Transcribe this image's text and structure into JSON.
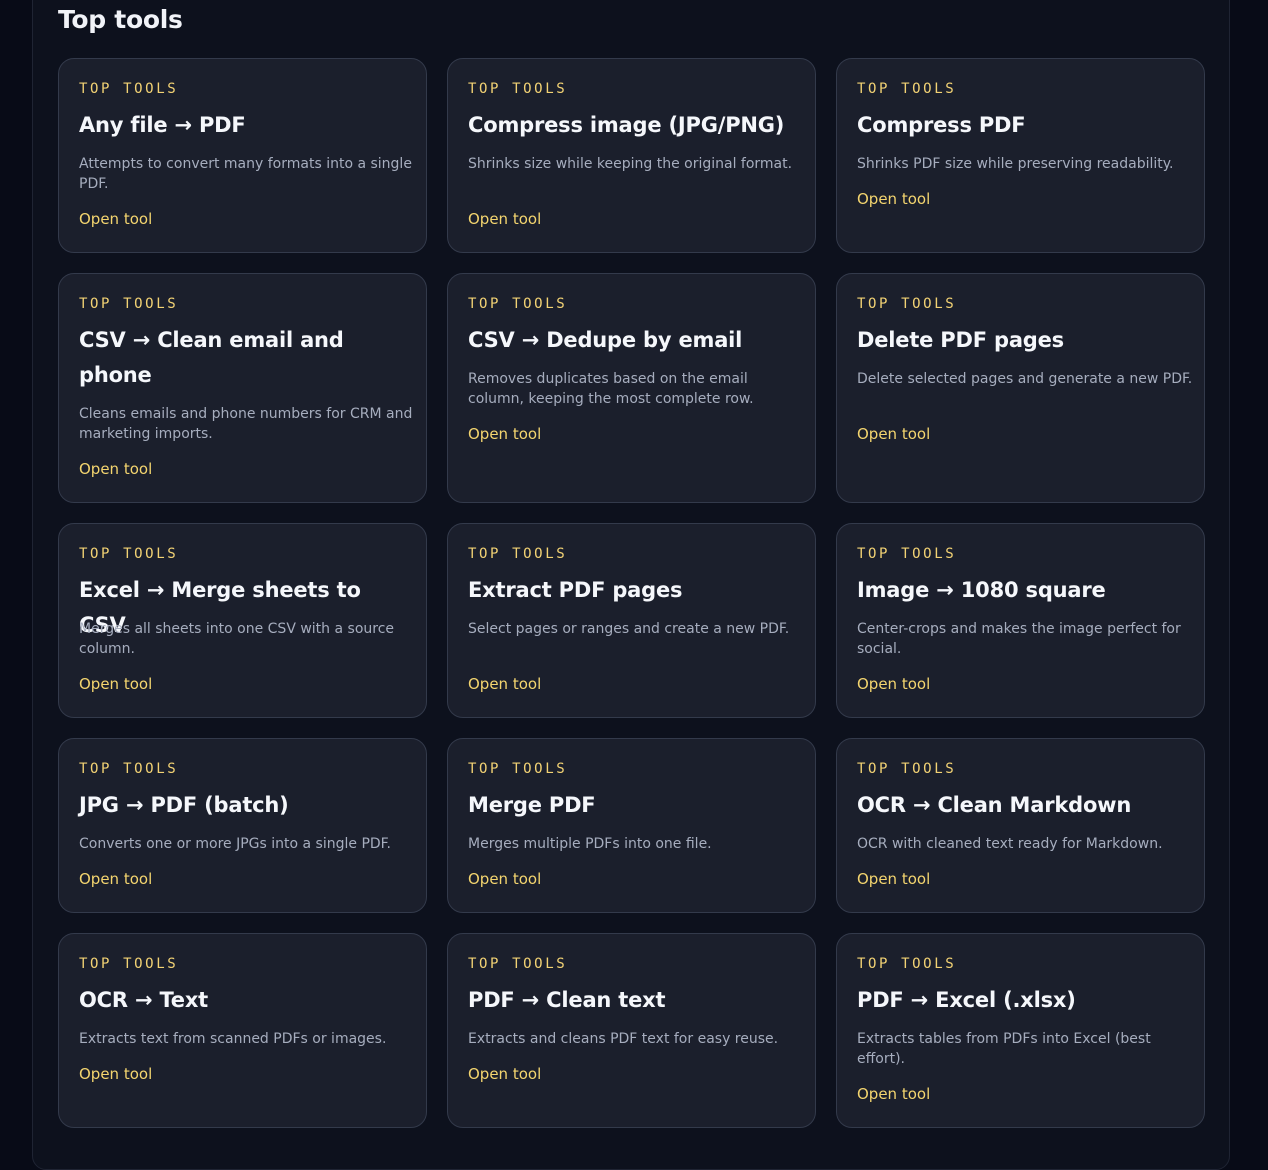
{
  "section": {
    "title": "Top tools"
  },
  "tools": [
    {
      "eyebrow": "TOP TOOLS",
      "title": "Any file → PDF",
      "description": "Attempts to convert many formats into a single PDF.",
      "link": "Open tool"
    },
    {
      "eyebrow": "TOP TOOLS",
      "title": "Compress image (JPG/PNG)",
      "description": "Shrinks size while keeping the original format.",
      "link": "Open tool"
    },
    {
      "eyebrow": "TOP TOOLS",
      "title": "Compress PDF",
      "description": "Shrinks PDF size while preserving readability.",
      "link": "Open tool"
    },
    {
      "eyebrow": "TOP TOOLS",
      "title": "CSV → Clean email and phone",
      "description": "Cleans emails and phone numbers for CRM and marketing imports.",
      "link": "Open tool"
    },
    {
      "eyebrow": "TOP TOOLS",
      "title": "CSV → Dedupe by email",
      "description": "Removes duplicates based on the email column, keeping the most complete row.",
      "link": "Open tool"
    },
    {
      "eyebrow": "TOP TOOLS",
      "title": "Delete PDF pages",
      "description": "Delete selected pages and generate a new PDF.",
      "link": "Open tool"
    },
    {
      "eyebrow": "TOP TOOLS",
      "title": "Excel → Merge sheets to CSV",
      "description": "Merges all sheets into one CSV with a source column.",
      "link": "Open tool"
    },
    {
      "eyebrow": "TOP TOOLS",
      "title": "Extract PDF pages",
      "description": "Select pages or ranges and create a new PDF.",
      "link": "Open tool"
    },
    {
      "eyebrow": "TOP TOOLS",
      "title": "Image → 1080 square",
      "description": "Center-crops and makes the image perfect for social.",
      "link": "Open tool"
    },
    {
      "eyebrow": "TOP TOOLS",
      "title": "JPG → PDF (batch)",
      "description": "Converts one or more JPGs into a single PDF.",
      "link": "Open tool"
    },
    {
      "eyebrow": "TOP TOOLS",
      "title": "Merge PDF",
      "description": "Merges multiple PDFs into one file.",
      "link": "Open tool"
    },
    {
      "eyebrow": "TOP TOOLS",
      "title": "OCR → Clean Markdown",
      "description": "OCR with cleaned text ready for Markdown.",
      "link": "Open tool"
    },
    {
      "eyebrow": "TOP TOOLS",
      "title": "OCR → Text",
      "description": "Extracts text from scanned PDFs or images.",
      "link": "Open tool"
    },
    {
      "eyebrow": "TOP TOOLS",
      "title": "PDF → Clean text",
      "description": "Extracts and cleans PDF text for easy reuse.",
      "link": "Open tool"
    },
    {
      "eyebrow": "TOP TOOLS",
      "title": "PDF → Excel (.xlsx)",
      "description": "Extracts tables from PDFs into Excel (best effort).",
      "link": "Open tool"
    }
  ]
}
